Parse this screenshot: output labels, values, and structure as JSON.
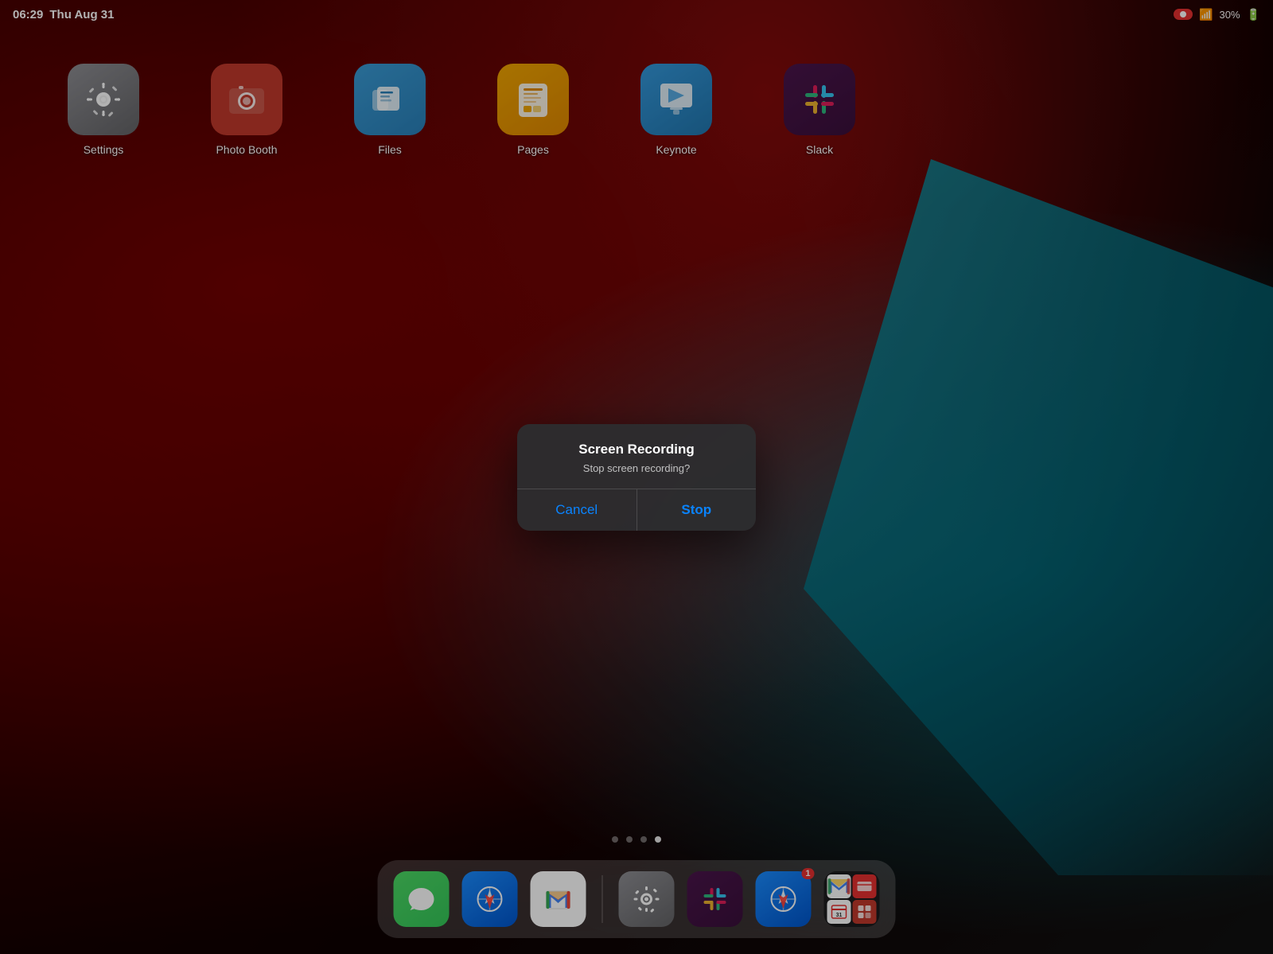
{
  "statusBar": {
    "time": "06:29",
    "date": "Thu Aug 31",
    "battery": "30%",
    "recording": true,
    "recordingLabel": ""
  },
  "apps": [
    {
      "id": "settings",
      "label": "Settings",
      "icon": "settings"
    },
    {
      "id": "photobooth",
      "label": "Photo Booth",
      "icon": "photobooth"
    },
    {
      "id": "files",
      "label": "Files",
      "icon": "files"
    },
    {
      "id": "pages",
      "label": "Pages",
      "icon": "pages"
    },
    {
      "id": "keynote",
      "label": "Keynote",
      "icon": "keynote"
    },
    {
      "id": "slack",
      "label": "Slack",
      "icon": "slack"
    }
  ],
  "pageDots": [
    {
      "active": false
    },
    {
      "active": false
    },
    {
      "active": false
    },
    {
      "active": true
    }
  ],
  "dock": {
    "main": [
      {
        "id": "messages",
        "icon": "messages",
        "label": "Messages"
      },
      {
        "id": "safari",
        "icon": "safari",
        "label": "Safari"
      },
      {
        "id": "gmail",
        "icon": "gmail",
        "label": "Gmail"
      }
    ],
    "recent": [
      {
        "id": "settings2",
        "icon": "settings",
        "label": "Settings"
      },
      {
        "id": "slack2",
        "icon": "slack",
        "label": "Slack"
      },
      {
        "id": "safari2",
        "icon": "safari",
        "label": "Safari"
      },
      {
        "id": "multi",
        "icon": "multi",
        "label": "Group"
      }
    ]
  },
  "dialog": {
    "title": "Screen Recording",
    "message": "Stop screen recording?",
    "cancelLabel": "Cancel",
    "stopLabel": "Stop"
  }
}
